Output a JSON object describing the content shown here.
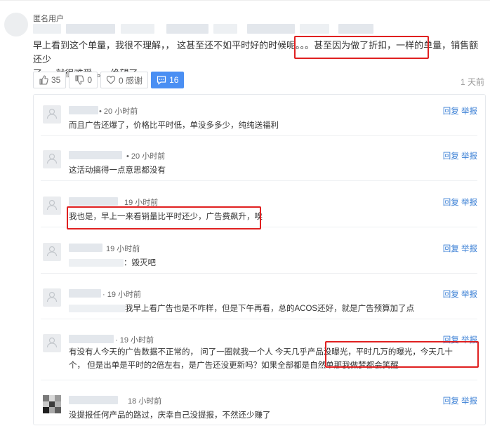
{
  "post": {
    "username": "匿名用户",
    "body_lines": [
      "早上看到这个单量，我很不理解，，  这甚至还不如平时好的时候呢。。。甚至因为做了折扣，一样的单量，销售额还少",
      "了，，就很难受。。。绝望了"
    ],
    "time": "1 天前"
  },
  "actions": {
    "like_count": "35",
    "dislike_count": "0",
    "thanks_label": "0 感谢",
    "comment_count": "16"
  },
  "reply_labels": {
    "reply": "回复",
    "report": "举报"
  },
  "replies": [
    {
      "time": "• 20 小时前",
      "text": "而且广告还爆了，价格比平时低，单没多多少，纯纯送福利"
    },
    {
      "time": "• 20 小时前",
      "text": "这活动搞得一点意思都没有"
    },
    {
      "time": "19 小时前",
      "text": "我也是，早上一来看销量比平时还少，广告费飙升，唉"
    },
    {
      "time": "19 小时前",
      "text": "：毁灭吧"
    },
    {
      "time": "· 19 小时前",
      "text": "我早上看广告也是不咋样，但是下午再看，总的ACOS还好，就是广告预算加了点"
    },
    {
      "time": "· 19 小时前",
      "text": "有没有人今天的广告数据不正常的，  问了一圈就我一个人 今天几乎产品没曝光，平时几万的曝光，今天几十个，  但是出单是平时的2倍左右，是广告还没更新吗？如果全部都是自然单那我做梦都会笑醒"
    },
    {
      "time": "18 小时前",
      "text": "没提报任何产品的路过，庆幸自己没提报，不然还少赚了"
    }
  ],
  "colors": {
    "accent": "#4a8ff3",
    "link": "#3a7fd5",
    "highlight": "#e02020"
  }
}
